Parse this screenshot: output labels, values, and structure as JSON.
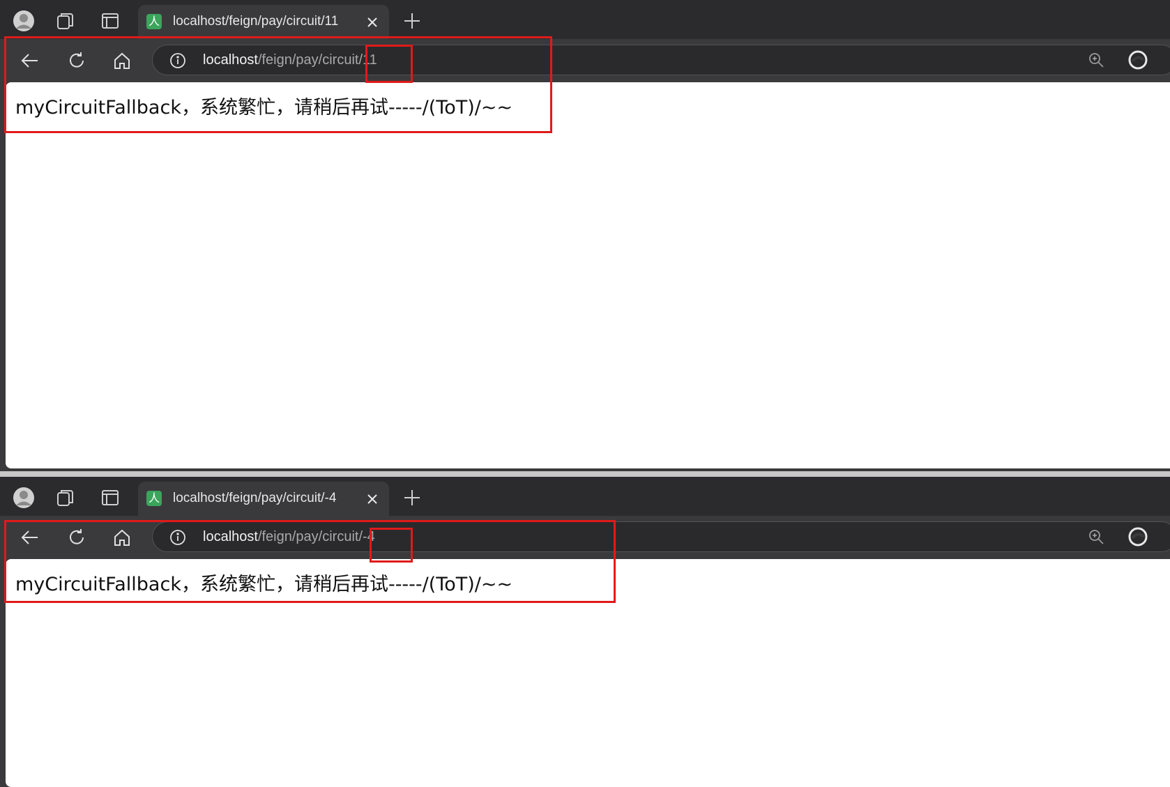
{
  "browsers": [
    {
      "tab": {
        "title": "localhost/feign/pay/circuit/11",
        "favicon_glyph": "人",
        "favicon_color": "#3ba55c"
      },
      "address": {
        "host": "localhost",
        "path": "/feign/pay/circuit/11"
      },
      "page": {
        "message": "myCircuitFallback，系统繁忙，请稍后再试-----/(ToT)/~~"
      }
    },
    {
      "tab": {
        "title": "localhost/feign/pay/circuit/-4",
        "favicon_glyph": "人",
        "favicon_color": "#3ba55c"
      },
      "address": {
        "host": "localhost",
        "path": "/feign/pay/circuit/-4"
      },
      "page": {
        "message": "myCircuitFallback，系统繁忙，请稍后再试-----/(ToT)/~~"
      }
    }
  ],
  "icons": [
    "profile-icon",
    "workspaces-icon",
    "vertical-tabs-icon",
    "close-icon",
    "plus-icon",
    "back-icon",
    "reload-icon",
    "home-icon",
    "info-icon",
    "zoom-icon",
    "edge-icon"
  ],
  "colors": {
    "highlight": "#e01a1a",
    "chrome_dark": "#2b2b2d",
    "toolbar": "#3a3a3c"
  }
}
